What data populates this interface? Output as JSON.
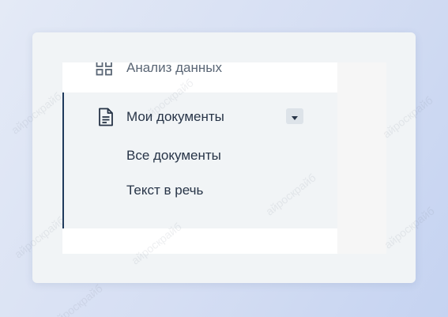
{
  "sidebar": {
    "items": [
      {
        "label": "Анализ данных",
        "icon": "grid-icon"
      },
      {
        "label": "Мои документы",
        "icon": "document-icon",
        "expanded": true,
        "children": [
          {
            "label": "Все документы"
          },
          {
            "label": "Текст в речь"
          }
        ]
      }
    ]
  },
  "watermark": {
    "text": "айроскрайб"
  },
  "colors": {
    "active_border": "#1f3a5c",
    "group_bg": "#f1f4f6",
    "text": "#273447"
  }
}
